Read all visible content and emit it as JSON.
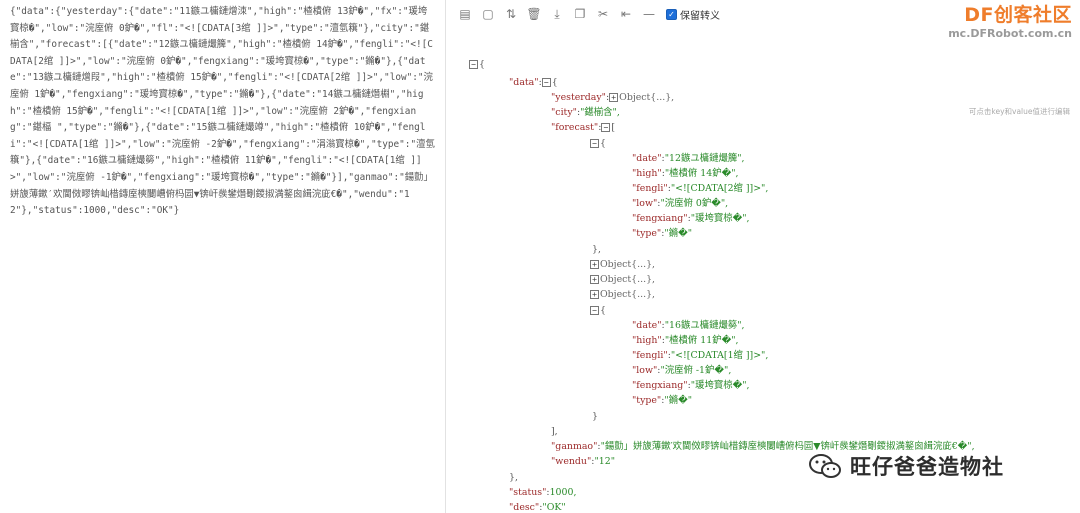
{
  "raw_json": "{\"data\":{\"yesterday\":{\"date\":\"11鏃ユ槦鏈熷洓\",\"high\":\"楂樻俯 13鈩�\",\"fx\":\"瑗垮寳椋�\",\"low\":\"浣庢俯 0鈩�\",\"fl\":\"<![CDATA[3绾 ]]>\",\"type\":\"澶氫簯\"},\"city\":\"鍖椾含\",\"forecast\":[{\"date\":\"12鏃ユ槦鏈熶簲\",\"high\":\"楂樻俯 14鈩�\",\"fengli\":\"<![CDATA[2绾 ]]>\",\"low\":\"浣庢俯 0鈩�\",\"fengxiang\":\"瑗垮寳椋�\",\"type\":\"鏅�\"},{\"date\":\"13鏃ユ槦鏈熷叚\",\"high\":\"楂樻俯 15鈩�\",\"fengli\":\"<![CDATA[2绾 ]]>\",\"low\":\"浣庢俯 1鈩�\",\"fengxiang\":\"瑗垮寳椋�\",\"type\":\"鏅�\"},{\"date\":\"14鏃ユ槦鏈熸棩\",\"high\":\"楂樻俯 15鈩�\",\"fengli\":\"<![CDATA[1绾 ]]>\",\"low\":\"浣庢俯 2鈩�\",\"fengxiang\":\"鍖楅 \",\"type\":\"鏅�\"},{\"date\":\"15鏃ユ槦鏈熶竴\",\"high\":\"楂樻俯 10鈩�\",\"fengli\":\"<![CDATA[1绾 ]]>\",\"low\":\"浣庢俯 -2鈩�\",\"fengxiang\":\"涓滃寳椋�\",\"type\":\"澶氫簯\"},{\"date\":\"16鏃ユ槦鏈熶簩\",\"high\":\"楂樻俯 11鈩�\",\"fengli\":\"<![CDATA[1绾 ]]>\",\"low\":\"浣庢俯 -1鈩�\",\"fengxiang\":\"瑗垮寳椋�\",\"type\":\"鏅�\"}],\"ganmao\":\"鍚勯」姘旇薄鏉′欢閫傚疁锛屾棤鏄庢樉闄嶆俯杩囩▼锛屽彂鐢熸劅鍐掓満鐜囪緝浣庛€�\",\"wendu\":\"12\"},\"status\":1000,\"desc\":\"OK\"}",
  "toolbar": {
    "icons": [
      "format-icon",
      "document-icon",
      "sort-icon",
      "delete-icon",
      "download-icon",
      "copy-icon",
      "compress-icon",
      "escape-icon",
      "minus-icon"
    ],
    "glyphs": [
      "▤",
      "▢",
      "⇅",
      "🗑",
      "⤓",
      "❐",
      "✂",
      "⇤",
      "—"
    ],
    "keep_escape_label": "保留转义",
    "keep_escape_checked": true
  },
  "logo": {
    "title": "DF创客社区",
    "url": "mc.DFRobot.com.cn"
  },
  "tree_hint": "可点击key和value值进行编辑",
  "tree": {
    "root_open": "{",
    "data_key": "\"data\"",
    "yesterday_key": "\"yesterday\"",
    "yesterday_collapsed": "Object{...},",
    "city_key": "\"city\"",
    "city_value": "\"鍖椾含\",",
    "forecast_key": "\"forecast\"",
    "obj_open": "{",
    "obj_close": "},",
    "obj_close_last": "}",
    "collapsed_object": "Object{...},",
    "arr_close": "],",
    "data_close": "},",
    "root_close": "}",
    "f0": {
      "date_key": "\"date\"",
      "date": "\"12鏃ユ槦鏈熶簲\",",
      "high_key": "\"high\"",
      "high": "\"楂樻俯 14鈩�\",",
      "fengli_key": "\"fengli\"",
      "fengli": "\"<![CDATA[2绾 ]]>\",",
      "low_key": "\"low\"",
      "low": "\"浣庢俯 0鈩�\",",
      "fengxiang_key": "\"fengxiang\"",
      "fengxiang": "\"瑗垮寳椋�\",",
      "type_key": "\"type\"",
      "type": "\"鏅�\""
    },
    "f4": {
      "date_key": "\"date\"",
      "date": "\"16鏃ユ槦鏈熶簩\",",
      "high_key": "\"high\"",
      "high": "\"楂樻俯 11鈩�\",",
      "fengli_key": "\"fengli\"",
      "fengli": "\"<![CDATA[1绾 ]]>\",",
      "low_key": "\"low\"",
      "low": "\"浣庢俯 -1鈩�\",",
      "fengxiang_key": "\"fengxiang\"",
      "fengxiang": "\"瑗垮寳椋�\",",
      "type_key": "\"type\"",
      "type": "\"鏅�\""
    },
    "ganmao_key": "\"ganmao\"",
    "ganmao": "\"鍚勯」姘旇薄鏉′欢閫傚疁锛屾棤鏄庢樉闄嶆俯杩囩▼锛屽彂鐢熸劅鍐掓満鐜囪緝浣庛€�\",",
    "wendu_key": "\"wendu\"",
    "wendu": "\"12\"",
    "status_key": "\"status\"",
    "status": "1000,",
    "desc_key": "\"desc\"",
    "desc": "\"OK\""
  },
  "watermark": {
    "text": "旺仔爸爸造物社"
  }
}
